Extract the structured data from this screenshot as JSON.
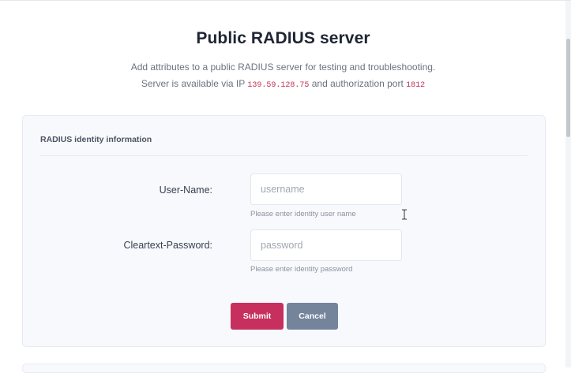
{
  "header": {
    "title": "Public RADIUS server",
    "description": "Add attributes to a public RADIUS server for testing and troubleshooting.",
    "server_line": {
      "prefix": "Server is available via IP",
      "ip": "139.59.128.75",
      "middle": "and authorization port",
      "port": "1812"
    }
  },
  "form": {
    "section_title": "RADIUS identity information",
    "fields": [
      {
        "label": "User-Name:",
        "value": "",
        "placeholder": "username",
        "help": "Please enter identity user name"
      },
      {
        "label": "Cleartext-Password:",
        "value": "",
        "placeholder": "password",
        "help": "Please enter identity password"
      }
    ],
    "submit_label": "Submit",
    "cancel_label": "Cancel"
  },
  "colors": {
    "accent_submit": "#c7305e",
    "cancel": "#73849b",
    "code": "#c2325a",
    "card_background": "#f7f9fc"
  },
  "icons": {
    "cursor": "text-cursor-icon"
  }
}
